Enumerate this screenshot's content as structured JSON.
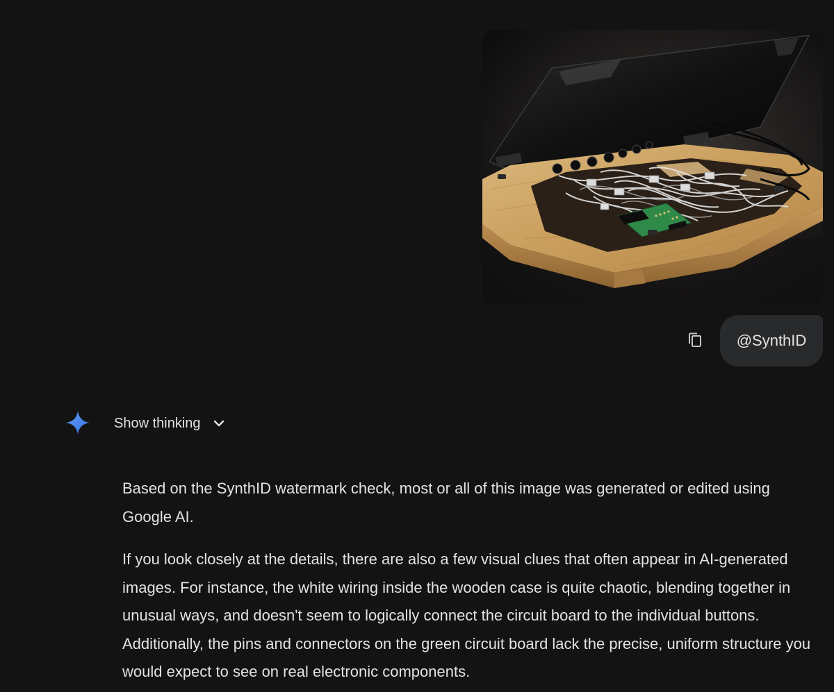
{
  "conversation": {
    "user_message": {
      "image_alt": "Wooden case with open lid containing white wiring, buttons and a green circuit board",
      "prompt_text": "@SynthID",
      "copy_icon": "copy-icon"
    },
    "model_response": {
      "avatar_icon": "gemini-sparkle-icon",
      "show_thinking_label": "Show thinking",
      "thinking_toggle_icon": "chevron-down-icon",
      "paragraphs": [
        "Based on the SynthID watermark check, most or all of this image was generated or edited using Google AI.",
        "If you look closely at the details, there are also a few visual clues that often appear in AI-generated images. For instance, the white wiring inside the wooden case is quite chaotic, blending together in unusual ways, and doesn't seem to logically connect the circuit board to the individual buttons. Additionally, the pins and connectors on the green circuit board lack the precise, uniform structure you would expect to see on real electronic components."
      ]
    }
  },
  "colors": {
    "background": "#131314",
    "bubble": "#282a2c",
    "text": "#e3e3e3",
    "gemini_blue": "#4285f4"
  }
}
